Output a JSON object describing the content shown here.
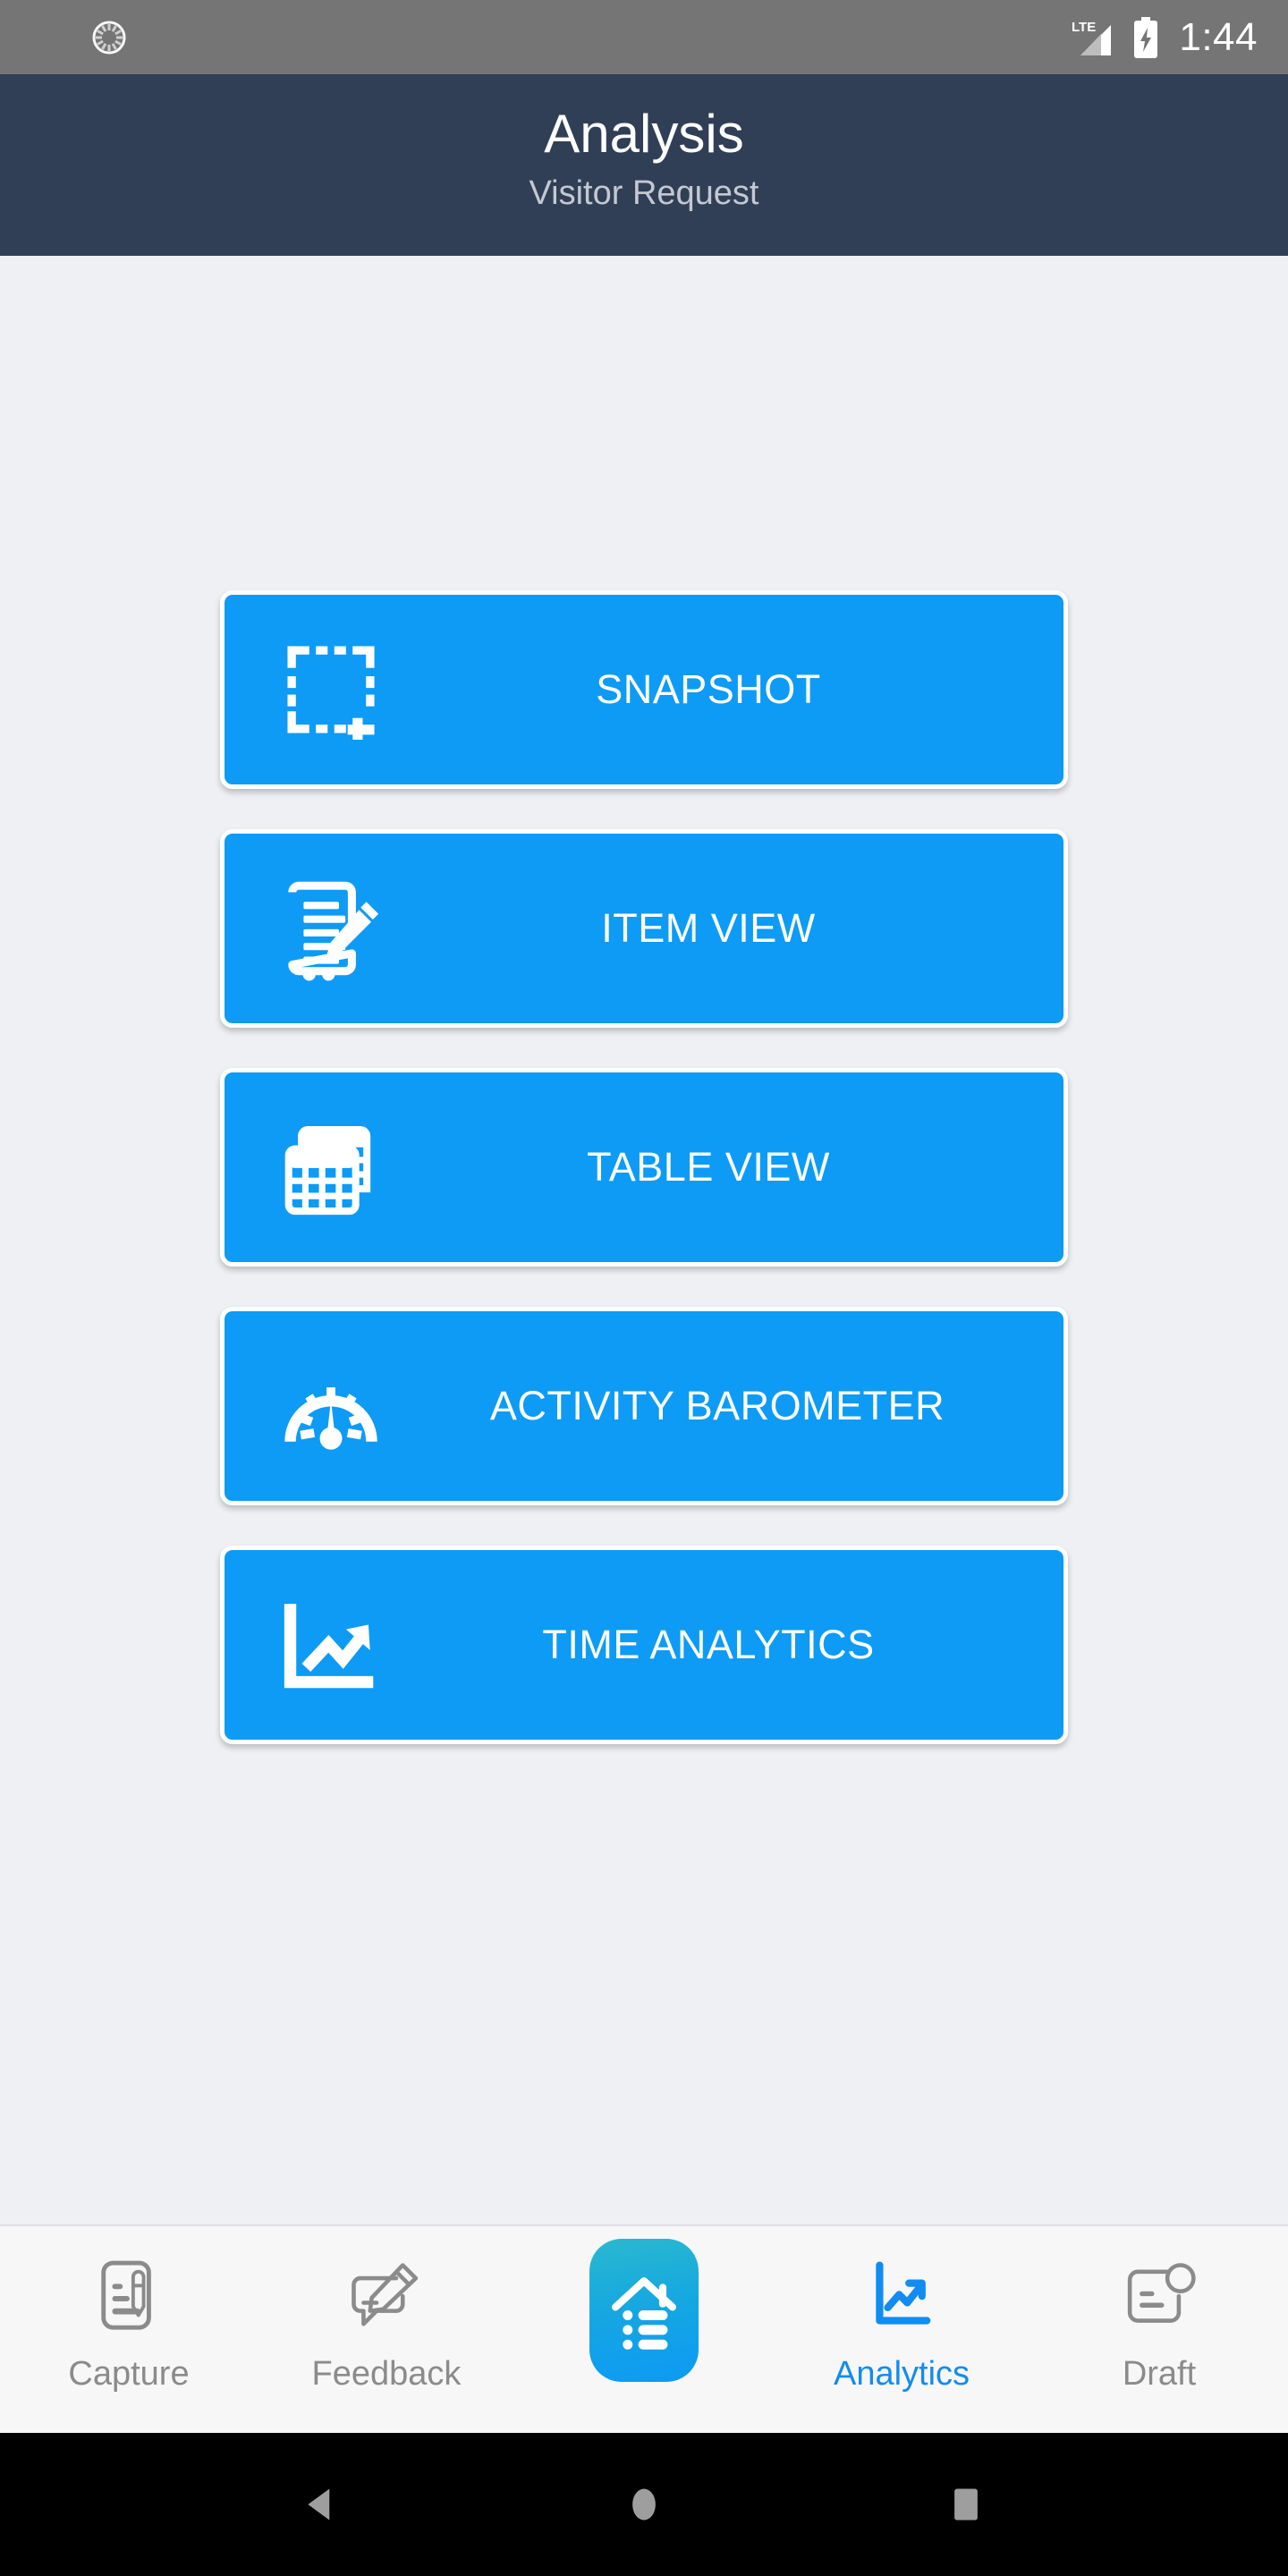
{
  "status_bar": {
    "sync_icon": "sync-spinner-icon",
    "network_label": "LTE",
    "signal_icon": "signal-bars-icon",
    "battery_icon": "battery-charging-icon",
    "time": "1:44",
    "background_color": "#757575",
    "foreground_color": "#ffffff"
  },
  "header": {
    "title": "Analysis",
    "subtitle": "Visitor Request",
    "background_color": "#313f56"
  },
  "main": {
    "background_color": "#eff0f4",
    "accent_color": "#0d9bf5",
    "buttons": [
      {
        "label": "SNAPSHOT",
        "icon": "dashed-crop-add-icon"
      },
      {
        "label": "ITEM VIEW",
        "icon": "document-pencil-icon"
      },
      {
        "label": "TABLE VIEW",
        "icon": "table-grid-icon"
      },
      {
        "label": "ACTIVITY BAROMETER",
        "icon": "gauge-meter-icon"
      },
      {
        "label": "TIME ANALYTICS",
        "icon": "line-chart-arrow-icon"
      }
    ]
  },
  "bottom_nav": {
    "background_color": "#f7f7f8",
    "inactive_color": "#8b8b8b",
    "active_color": "#128cf0",
    "items": [
      {
        "label": "Capture",
        "icon": "note-pencil-icon",
        "active": false
      },
      {
        "label": "Feedback",
        "icon": "speech-bubble-pencil-icon",
        "active": false
      },
      {
        "label": "",
        "icon": "home-list-center-icon",
        "active": false
      },
      {
        "label": "Analytics",
        "icon": "chart-arrow-icon",
        "active": true
      },
      {
        "label": "Draft",
        "icon": "draft-badge-icon",
        "active": false
      }
    ]
  },
  "system_nav": {
    "background_color": "#000000",
    "icon_color": "#9e9e9e",
    "buttons": [
      {
        "label": "back",
        "icon": "back-triangle-icon"
      },
      {
        "label": "home",
        "icon": "home-circle-icon"
      },
      {
        "label": "recents",
        "icon": "recents-square-icon"
      }
    ]
  }
}
